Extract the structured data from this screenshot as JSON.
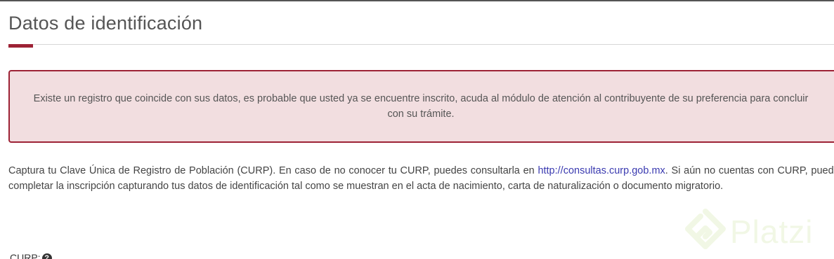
{
  "section": {
    "title": "Datos de identificación"
  },
  "alert": {
    "message": "Existe un registro que coincide con sus datos, es probable que usted ya se encuentre inscrito, acuda al módulo de atención al contribuyente de su preferencia para concluir con su trámite."
  },
  "intro": {
    "before_link": "Captura tu Clave Única de Registro de Población (CURP). En caso de no conocer tu CURP, puedes consultarla en ",
    "link_text": "http://consultas.curp.gob.mx",
    "after_link": ". Si aún no cuentas con CURP, puedes completar la inscripción capturando tus datos de identificación tal como se muestran en el acta de nacimiento, carta de naturalización o documento migratorio."
  },
  "form": {
    "curp_label": "CURP:",
    "help_glyph": "?"
  },
  "watermark": {
    "text": "Platzi"
  },
  "colors": {
    "accent": "#9d2235",
    "alert_bg": "#f2dee0",
    "link": "#3a3ab0",
    "watermark": "#98ca3f"
  }
}
